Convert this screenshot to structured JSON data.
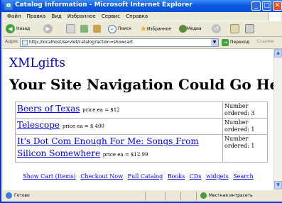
{
  "window": {
    "title": "Catalog Information - Microsoft Internet Explorer",
    "controls": {
      "minimize": "_",
      "maximize": "□",
      "close": "✕"
    }
  },
  "menubar": {
    "items": [
      "Файл",
      "Правка",
      "Вид",
      "Избранное",
      "Сервис",
      "Справка"
    ]
  },
  "toolbar": {
    "back_label": "Назад",
    "search_label": "Поиск",
    "favorites_label": "Избранное",
    "media_label": "Медиа"
  },
  "addressbar": {
    "label": "Адрес",
    "url": "http://localhost/servlet/catalog?action=showcart",
    "go_label": "Переход",
    "links_label": "Ссылки"
  },
  "page": {
    "logo": "XMLgifts",
    "heading": "Your Site Navigation Could Go Here",
    "cart_items": [
      {
        "name": "Beers of Texas",
        "price": "price ea = $12",
        "qty_label": "Number ordered:",
        "qty": "3"
      },
      {
        "name": "Telescope",
        "price": "price ea = $ 400",
        "qty_label": "Number ordered:",
        "qty": "1"
      },
      {
        "name": "It's Dot Com Enough For Me: Songs From Silicon Somewhere",
        "price": "price ea = $12.99",
        "qty_label": "Number ordered:",
        "qty": "1"
      }
    ],
    "nav_links": [
      "Show Cart (Items)",
      "Checkout Now",
      "Full Catalog",
      "Books",
      "CDs",
      "widgets",
      "Search"
    ]
  },
  "statusbar": {
    "left": "Готово",
    "zone": "Местная интрасеть"
  }
}
